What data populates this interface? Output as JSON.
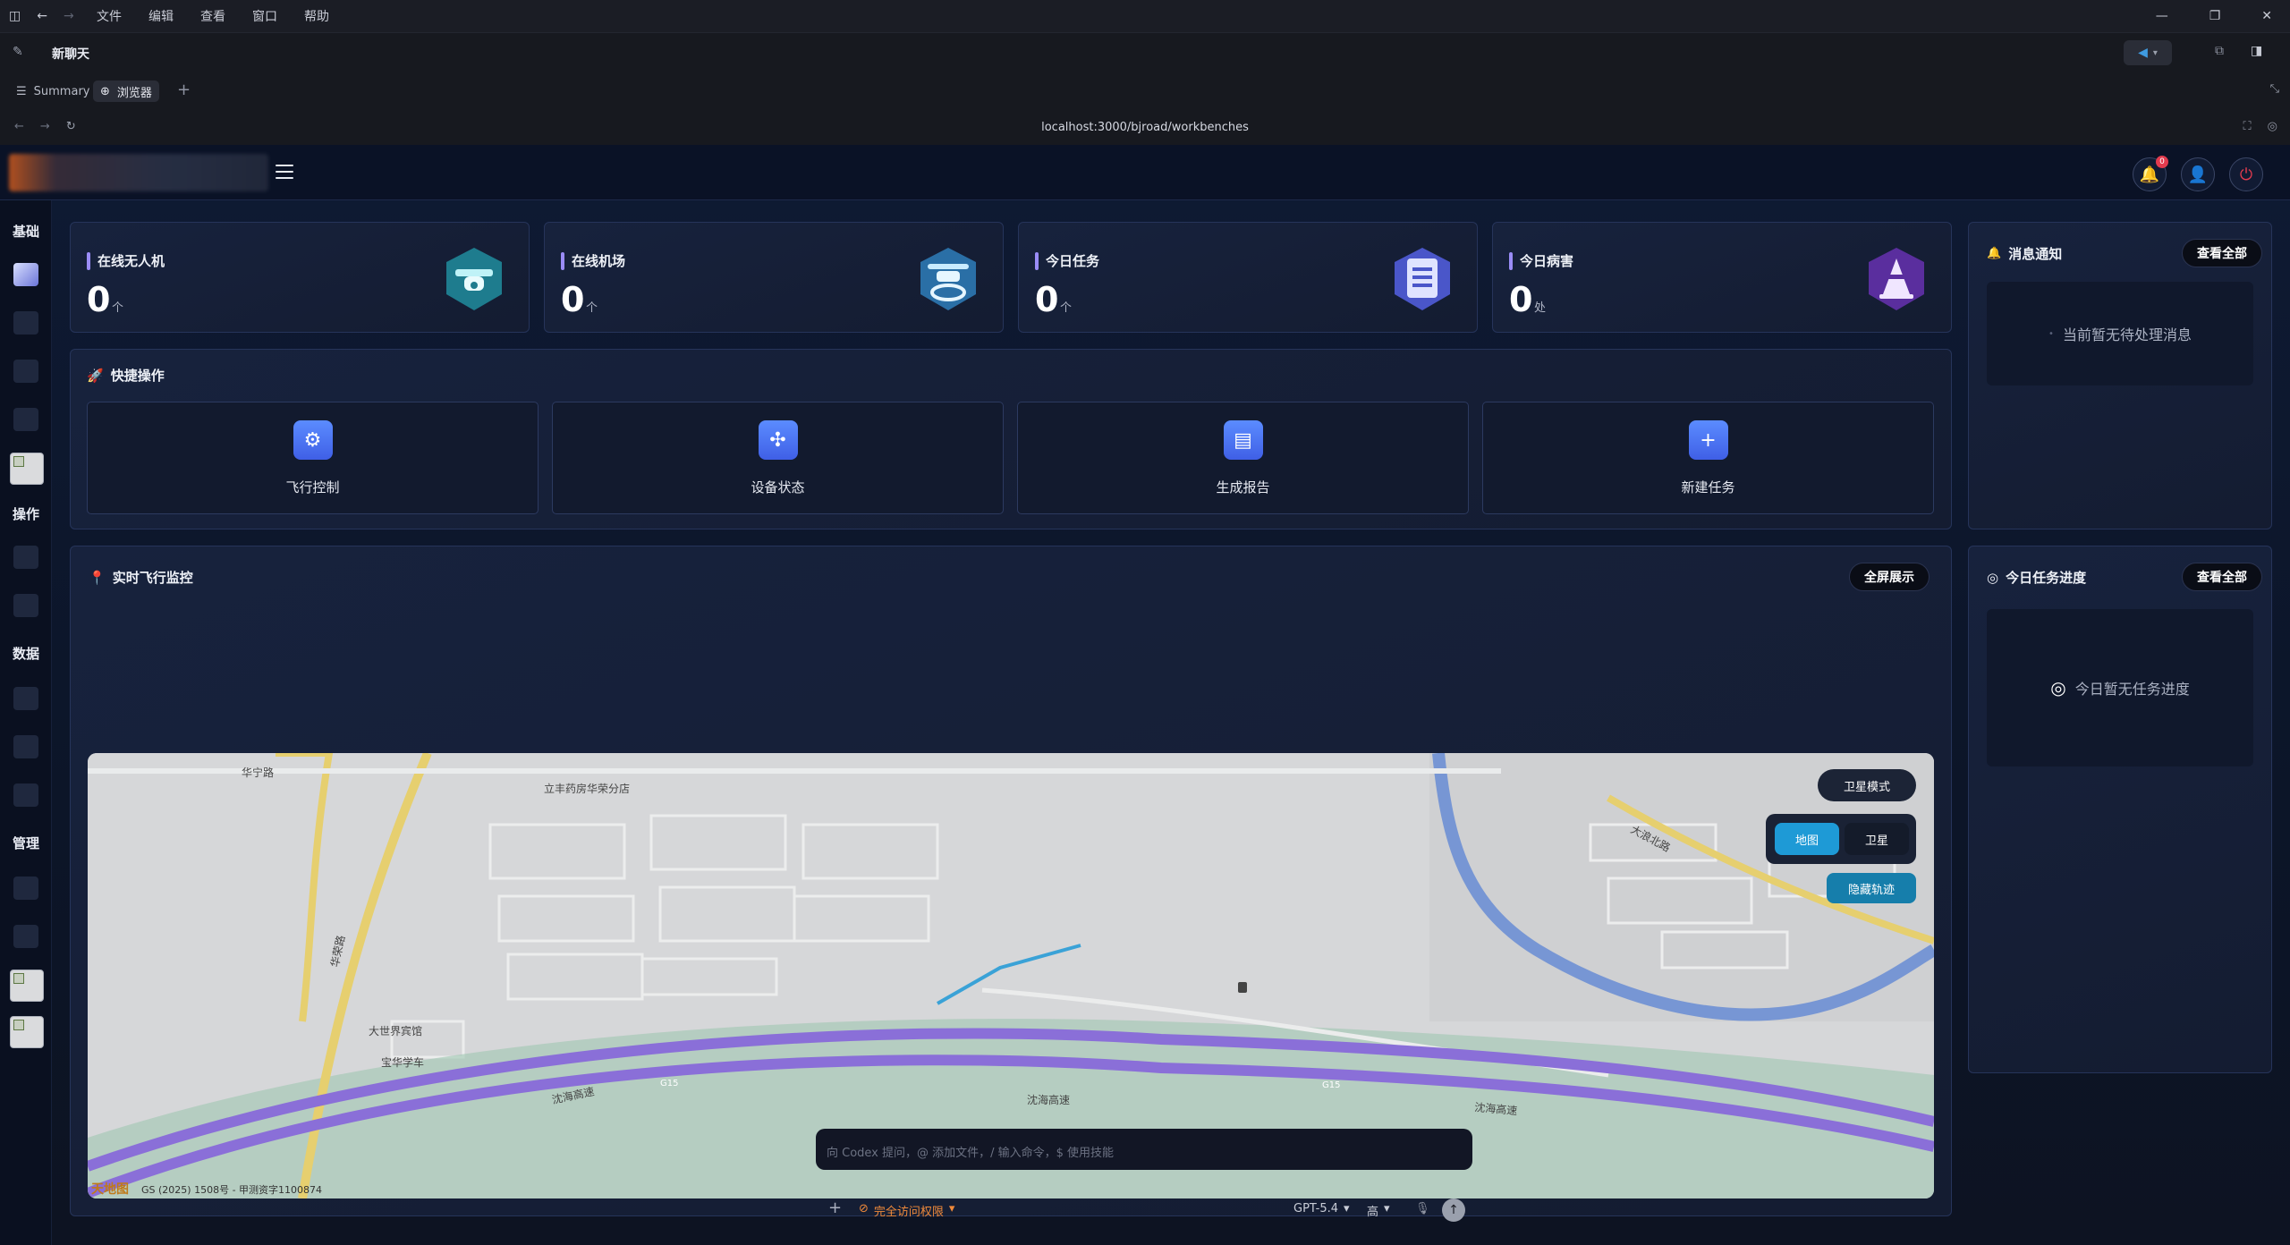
{
  "os_menu": {
    "items": [
      "文件",
      "编辑",
      "查看",
      "窗口",
      "帮助"
    ]
  },
  "chat": {
    "title": "新聊天"
  },
  "tabs": {
    "summary": "Summary",
    "browser": "浏览器"
  },
  "address": {
    "url": "localhost:3000/bjroad/workbenches"
  },
  "header": {
    "notification_count": "0"
  },
  "sidenav": {
    "groups": [
      "基础",
      "操作",
      "数据",
      "管理"
    ]
  },
  "stats": [
    {
      "label": "在线无人机",
      "value": "0",
      "unit": "个"
    },
    {
      "label": "在线机场",
      "value": "0",
      "unit": "个"
    },
    {
      "label": "今日任务",
      "value": "0",
      "unit": "个"
    },
    {
      "label": "今日病害",
      "value": "0",
      "unit": "处"
    }
  ],
  "quick_actions": {
    "title": "快捷操作",
    "items": [
      {
        "label": "飞行控制",
        "icon": "sliders-icon"
      },
      {
        "label": "设备状态",
        "icon": "drone-network-icon"
      },
      {
        "label": "生成报告",
        "icon": "report-icon"
      },
      {
        "label": "新建任务",
        "icon": "plus-icon"
      }
    ]
  },
  "notifications": {
    "title": "消息通知",
    "view_all": "查看全部",
    "empty": "当前暂无待处理消息"
  },
  "monitor": {
    "title": "实时飞行监控",
    "fullscreen": "全屏展示",
    "satellite_mode": "卫星模式",
    "map_toggle": "地图",
    "sat_toggle": "卫星",
    "hide_track": "隐藏轨迹",
    "map_labels": {
      "road1": "华宁路",
      "poi1": "立丰药房华荣分店",
      "road2": "大浪北路",
      "poi2": "大世界宾馆",
      "poi3": "宝华学车",
      "road3": "华荣路",
      "highway": "沈海高速",
      "g15": "G15",
      "copyright": "GS (2025) 1508号 - 甲测资字1100874",
      "logo": "天地图"
    }
  },
  "progress": {
    "title": "今日任务进度",
    "view_all": "查看全部",
    "empty": "今日暂无任务进度"
  },
  "composer": {
    "placeholder": "向 Codex 提问，@ 添加文件，/ 输入命令，$ 使用技能",
    "access": "完全访问权限",
    "model": "GPT-5.4",
    "level": "高"
  },
  "colors": {
    "accent": "#5b8cff",
    "map_toggle_active": "#1e9ad6",
    "highway": "#8a6fd8",
    "river": "#6f93d8"
  }
}
